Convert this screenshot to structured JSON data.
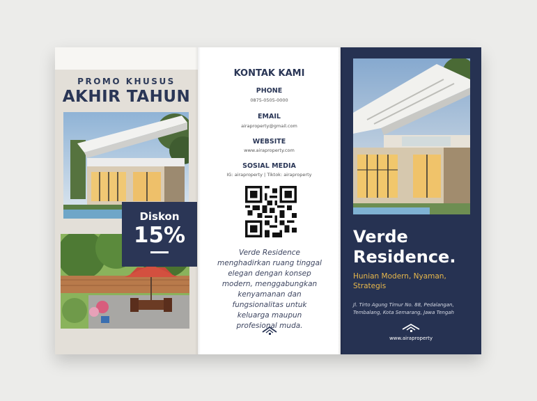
{
  "left_panel": {
    "promo_label": "PROMO KHUSUS",
    "promo_title": "AKHIR TAHUN",
    "discount_label": "Diskon",
    "discount_value": "15%"
  },
  "middle_panel": {
    "heading": "KONTAK KAMI",
    "contacts": [
      {
        "label": "PHONE",
        "value": "0875-0505-0000"
      },
      {
        "label": "EMAIL",
        "value": "airaproperty@gmail.com"
      },
      {
        "label": "WEBSITE",
        "value": "www.airaproperty.com"
      },
      {
        "label": "SOSIAL MEDIA",
        "value": "IG: airaproperty | Tiktok: airaproperty"
      }
    ],
    "qr_icon": "qr-code",
    "description": "Verde Residence menghadirkan ruang tinggal elegan dengan konsep modern, menggabungkan kenyamanan dan fungsionalitas untuk keluarga maupun profesional muda.",
    "logo_icon": "house-logo"
  },
  "right_panel": {
    "title_line1": "Verde",
    "title_line2": "Residence.",
    "subtitle_line1": "Hunian Modern, Nyaman,",
    "subtitle_line2": "Strategis",
    "address_line1": "Jl. Tirto Agung Timur No. 88, Pedalangan,",
    "address_line2": "Tembalang, Kota Semarang, Jawa Tengah",
    "logo_icon": "house-logo",
    "website": "www.airaproperty"
  },
  "colors": {
    "navy": "#263252",
    "accent_gold": "#e8b84b",
    "left_bg": "#e3dfd8",
    "page_bg": "#ececea"
  }
}
